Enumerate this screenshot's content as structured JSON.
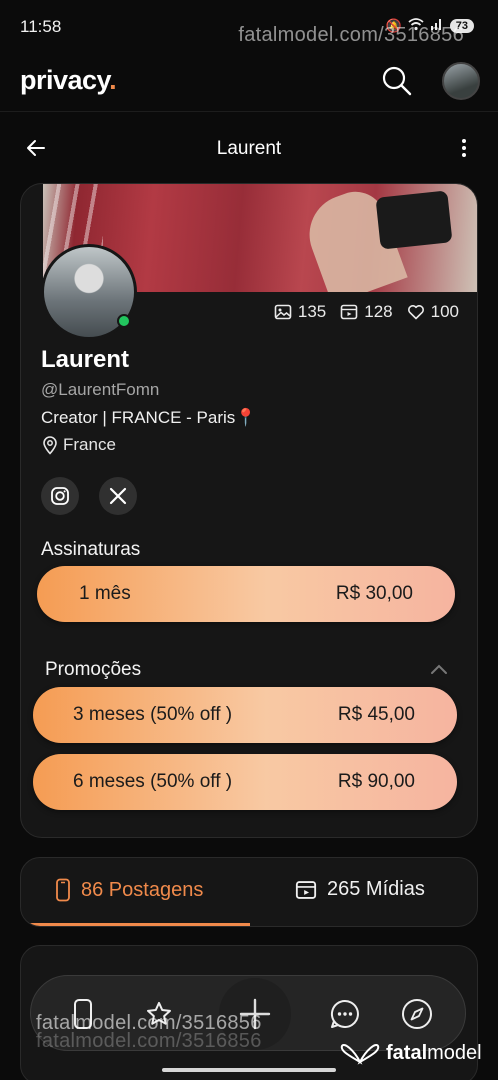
{
  "status": {
    "time": "11:58",
    "battery": "73"
  },
  "watermark": {
    "text": "fatalmodel.com/3516856"
  },
  "header": {
    "logo": "privacy",
    "logo_dot": "."
  },
  "page": {
    "title": "Laurent"
  },
  "profile": {
    "name": "Laurent",
    "handle": "@LaurentFomn",
    "bio": "Creator | FRANCE - Paris📍",
    "location": "France",
    "stats": {
      "images": "135",
      "videos": "128",
      "likes": "100"
    },
    "online": true
  },
  "subscriptions": {
    "label": "Assinaturas",
    "plans": [
      {
        "period": "1 mês",
        "price": "R$ 30,00"
      }
    ]
  },
  "promotions": {
    "label": "Promoções",
    "plans": [
      {
        "period": "3 meses (50% off )",
        "price": "R$ 45,00"
      },
      {
        "period": "6 meses (50% off )",
        "price": "R$ 90,00"
      }
    ]
  },
  "tabs": [
    {
      "label": "86 Postagens",
      "active": true
    },
    {
      "label": "265 Mídias",
      "active": false
    }
  ],
  "brand_footer": {
    "prefix": "fatal",
    "suffix": "model"
  },
  "colors": {
    "accent": "#f08a4b",
    "online": "#22c55e",
    "background": "#0b0b0b",
    "card": "#161616"
  }
}
